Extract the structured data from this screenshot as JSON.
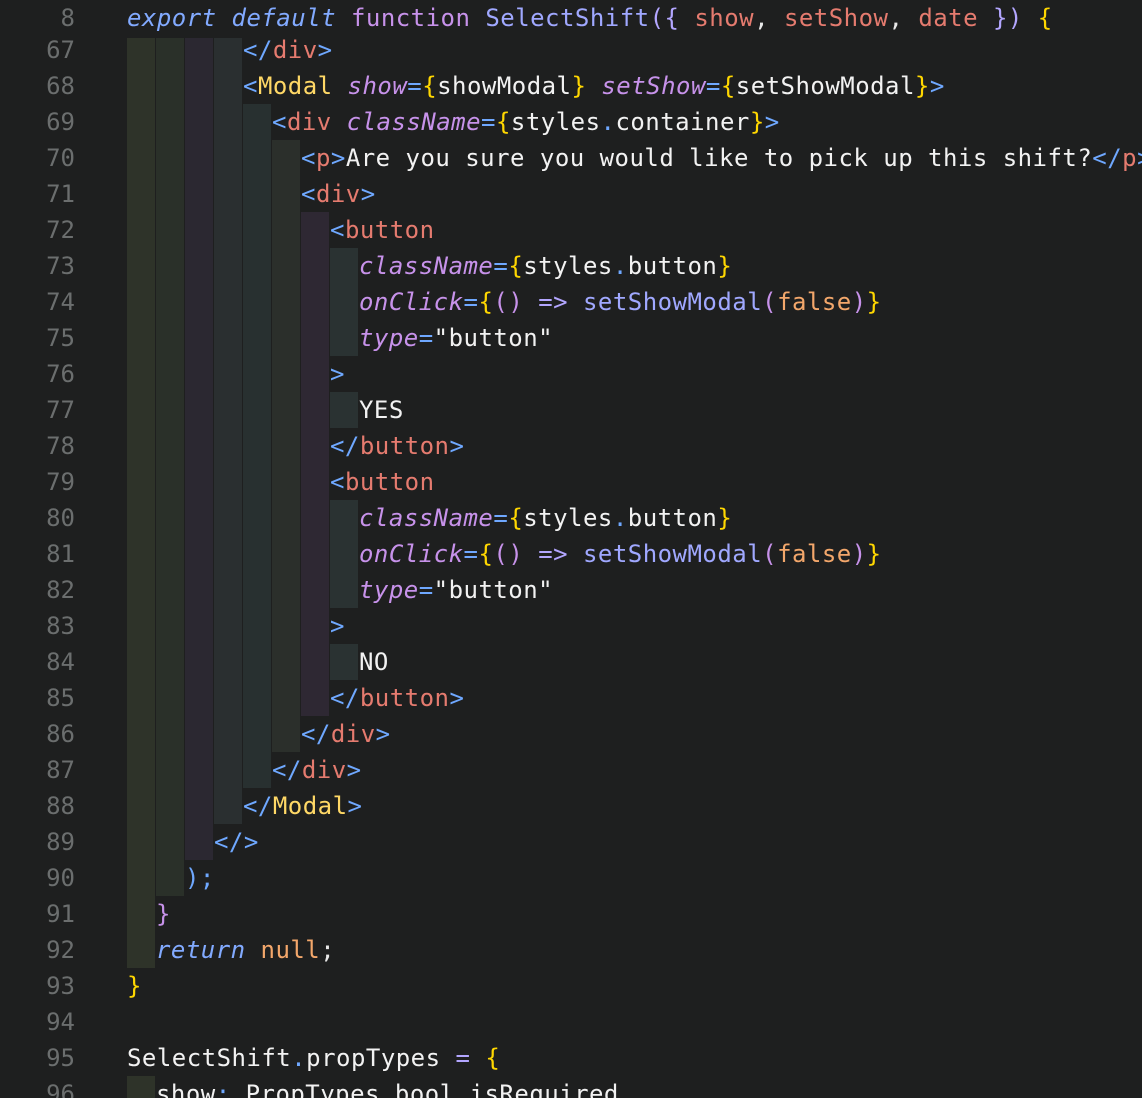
{
  "sticky": {
    "number": "8",
    "tokens": [
      [
        "k",
        "export"
      ],
      [
        "s",
        " "
      ],
      [
        "k",
        "default"
      ],
      [
        "s",
        " "
      ],
      [
        "kw",
        "function"
      ],
      [
        "s",
        " "
      ],
      [
        "fn",
        "SelectShift"
      ],
      [
        "op",
        "({"
      ],
      [
        "s",
        " "
      ],
      [
        "par",
        "show"
      ],
      [
        "s",
        ", "
      ],
      [
        "par",
        "setShow"
      ],
      [
        "s",
        ", "
      ],
      [
        "par",
        "date"
      ],
      [
        "s",
        " "
      ],
      [
        "op",
        "})"
      ],
      [
        "s",
        " "
      ],
      [
        "b",
        "{"
      ]
    ]
  },
  "lines": [
    {
      "number": "67",
      "indent": 4,
      "tokens": [
        [
          "p",
          "</"
        ],
        [
          "t",
          "div"
        ],
        [
          "p",
          ">"
        ]
      ]
    },
    {
      "number": "68",
      "indent": 4,
      "tokens": [
        [
          "p",
          "<"
        ],
        [
          "c",
          "Modal"
        ],
        [
          "s",
          " "
        ],
        [
          "a",
          "show"
        ],
        [
          "p",
          "="
        ],
        [
          "b",
          "{"
        ],
        [
          "txt",
          "showModal"
        ],
        [
          "b",
          "}"
        ],
        [
          "s",
          " "
        ],
        [
          "a",
          "setShow"
        ],
        [
          "p",
          "="
        ],
        [
          "b",
          "{"
        ],
        [
          "txt",
          "setShowModal"
        ],
        [
          "b",
          "}"
        ],
        [
          "p",
          ">"
        ]
      ]
    },
    {
      "number": "69",
      "indent": 5,
      "tokens": [
        [
          "p",
          "<"
        ],
        [
          "t",
          "div"
        ],
        [
          "s",
          " "
        ],
        [
          "a",
          "className"
        ],
        [
          "p",
          "="
        ],
        [
          "b",
          "{"
        ],
        [
          "txt",
          "styles"
        ],
        [
          "p",
          "."
        ],
        [
          "txt",
          "container"
        ],
        [
          "b",
          "}"
        ],
        [
          "p",
          ">"
        ]
      ]
    },
    {
      "number": "70",
      "indent": 6,
      "tokens": [
        [
          "p",
          "<"
        ],
        [
          "t",
          "p"
        ],
        [
          "p",
          ">"
        ],
        [
          "txt",
          "Are you sure you would like to pick up this shift?"
        ],
        [
          "p",
          "</"
        ],
        [
          "t",
          "p"
        ],
        [
          "p",
          ">"
        ]
      ]
    },
    {
      "number": "71",
      "indent": 6,
      "tokens": [
        [
          "p",
          "<"
        ],
        [
          "t",
          "div"
        ],
        [
          "p",
          ">"
        ]
      ]
    },
    {
      "number": "72",
      "indent": 7,
      "tokens": [
        [
          "p",
          "<"
        ],
        [
          "t",
          "button"
        ]
      ]
    },
    {
      "number": "73",
      "indent": 8,
      "tokens": [
        [
          "a",
          "className"
        ],
        [
          "p",
          "="
        ],
        [
          "b",
          "{"
        ],
        [
          "txt",
          "styles"
        ],
        [
          "p",
          "."
        ],
        [
          "txt",
          "button"
        ],
        [
          "b",
          "}"
        ]
      ]
    },
    {
      "number": "74",
      "indent": 8,
      "tokens": [
        [
          "a",
          "onClick"
        ],
        [
          "p",
          "="
        ],
        [
          "b",
          "{"
        ],
        [
          "kw",
          "()"
        ],
        [
          "s",
          " "
        ],
        [
          "op",
          "=>"
        ],
        [
          "s",
          " "
        ],
        [
          "fn",
          "setShowModal"
        ],
        [
          "kw",
          "("
        ],
        [
          "lit",
          "false"
        ],
        [
          "kw",
          ")"
        ],
        [
          "b",
          "}"
        ]
      ]
    },
    {
      "number": "75",
      "indent": 8,
      "tokens": [
        [
          "a",
          "type"
        ],
        [
          "p",
          "="
        ],
        [
          "str",
          "\"button\""
        ]
      ]
    },
    {
      "number": "76",
      "indent": 7,
      "tokens": [
        [
          "p",
          ">"
        ]
      ]
    },
    {
      "number": "77",
      "indent": 8,
      "tokens": [
        [
          "txt",
          "YES"
        ]
      ]
    },
    {
      "number": "78",
      "indent": 7,
      "tokens": [
        [
          "p",
          "</"
        ],
        [
          "t",
          "button"
        ],
        [
          "p",
          ">"
        ]
      ]
    },
    {
      "number": "79",
      "indent": 7,
      "tokens": [
        [
          "p",
          "<"
        ],
        [
          "t",
          "button"
        ]
      ]
    },
    {
      "number": "80",
      "indent": 8,
      "tokens": [
        [
          "a",
          "className"
        ],
        [
          "p",
          "="
        ],
        [
          "b",
          "{"
        ],
        [
          "txt",
          "styles"
        ],
        [
          "p",
          "."
        ],
        [
          "txt",
          "button"
        ],
        [
          "b",
          "}"
        ]
      ]
    },
    {
      "number": "81",
      "indent": 8,
      "tokens": [
        [
          "a",
          "onClick"
        ],
        [
          "p",
          "="
        ],
        [
          "b",
          "{"
        ],
        [
          "kw",
          "()"
        ],
        [
          "s",
          " "
        ],
        [
          "op",
          "=>"
        ],
        [
          "s",
          " "
        ],
        [
          "fn",
          "setShowModal"
        ],
        [
          "kw",
          "("
        ],
        [
          "lit",
          "false"
        ],
        [
          "kw",
          ")"
        ],
        [
          "b",
          "}"
        ]
      ]
    },
    {
      "number": "82",
      "indent": 8,
      "tokens": [
        [
          "a",
          "type"
        ],
        [
          "p",
          "="
        ],
        [
          "str",
          "\"button\""
        ]
      ]
    },
    {
      "number": "83",
      "indent": 7,
      "tokens": [
        [
          "p",
          ">"
        ]
      ]
    },
    {
      "number": "84",
      "indent": 8,
      "tokens": [
        [
          "txt",
          "NO"
        ]
      ]
    },
    {
      "number": "85",
      "indent": 7,
      "tokens": [
        [
          "p",
          "</"
        ],
        [
          "t",
          "button"
        ],
        [
          "p",
          ">"
        ]
      ]
    },
    {
      "number": "86",
      "indent": 6,
      "tokens": [
        [
          "p",
          "</"
        ],
        [
          "t",
          "div"
        ],
        [
          "p",
          ">"
        ]
      ]
    },
    {
      "number": "87",
      "indent": 5,
      "tokens": [
        [
          "p",
          "</"
        ],
        [
          "t",
          "div"
        ],
        [
          "p",
          ">"
        ]
      ]
    },
    {
      "number": "88",
      "indent": 4,
      "tokens": [
        [
          "p",
          "</"
        ],
        [
          "c",
          "Modal"
        ],
        [
          "p",
          ">"
        ]
      ]
    },
    {
      "number": "89",
      "indent": 3,
      "tokens": [
        [
          "p",
          "</>"
        ]
      ]
    },
    {
      "number": "90",
      "indent": 2,
      "tokens": [
        [
          "p",
          ");"
        ]
      ]
    },
    {
      "number": "91",
      "indent": 1,
      "tokens": [
        [
          "kw",
          "}"
        ]
      ]
    },
    {
      "number": "92",
      "indent": 1,
      "tokens": [
        [
          "k",
          "return"
        ],
        [
          "s",
          " "
        ],
        [
          "lit",
          "null"
        ],
        [
          "s",
          ";"
        ]
      ]
    },
    {
      "number": "93",
      "indent": 0,
      "tokens": [
        [
          "b",
          "}"
        ]
      ]
    },
    {
      "number": "94",
      "indent": 0,
      "tokens": []
    },
    {
      "number": "95",
      "indent": 0,
      "tokens": [
        [
          "txt",
          "SelectShift"
        ],
        [
          "p",
          "."
        ],
        [
          "txt",
          "propTypes"
        ],
        [
          "s",
          " "
        ],
        [
          "op",
          "="
        ],
        [
          "s",
          " "
        ],
        [
          "b",
          "{"
        ]
      ]
    },
    {
      "number": "96",
      "indent": 1,
      "tokens": [
        [
          "txt",
          "show"
        ],
        [
          "p",
          ":"
        ],
        [
          "s",
          " "
        ],
        [
          "txt",
          "PropTypes"
        ],
        [
          "p",
          "."
        ],
        [
          "txt",
          "bool"
        ],
        [
          "p",
          "."
        ],
        [
          "txt",
          "isRequired"
        ]
      ]
    }
  ],
  "guide_colors": [
    "#2e3329",
    "#2a3029",
    "#2b2831",
    "#2a2f30",
    "#283030",
    "#2b2f2b",
    "#2e2833",
    "#2a3232"
  ]
}
